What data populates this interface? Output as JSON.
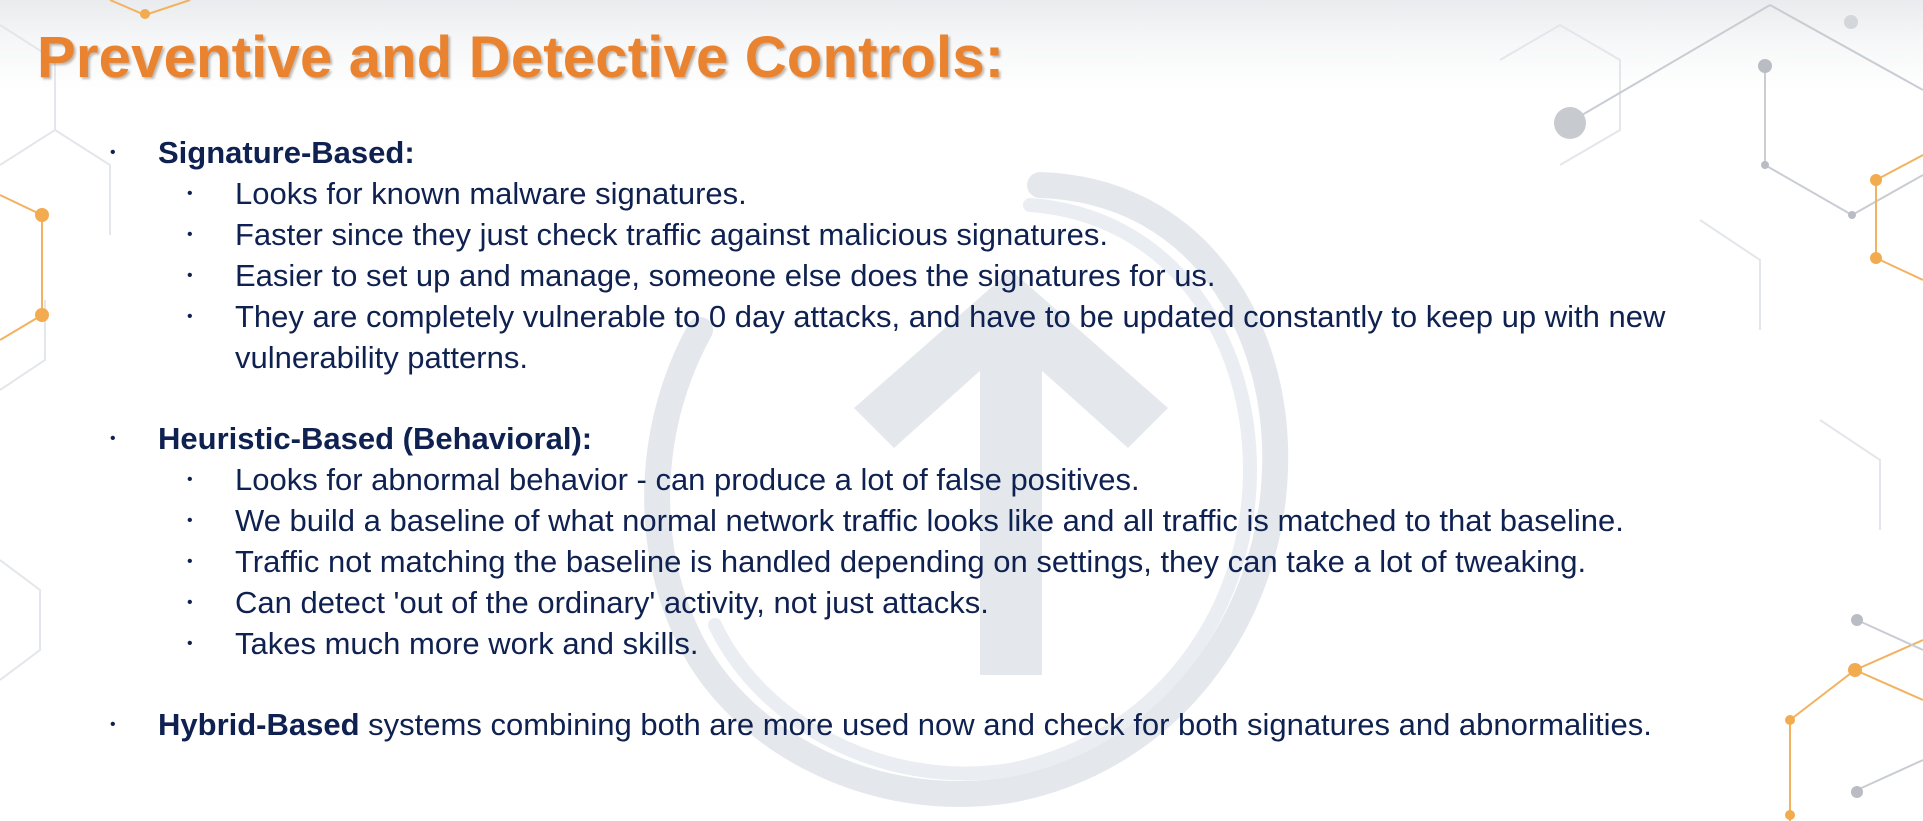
{
  "slide": {
    "title": "Preventive and Detective Controls:",
    "bullet_glyph": "•",
    "accent_color": "#e9832f",
    "text_color": "#0f2150"
  },
  "signature": {
    "heading": "Signature-Based:",
    "items": [
      "Looks for known malware signatures.",
      "Faster since they just check traffic against malicious signatures.",
      "Easier to set up and manage, someone else does the signatures for us.",
      "They are completely vulnerable to 0 day attacks, and have to be updated constantly to keep up with new"
    ],
    "item4_continuation": "vulnerability patterns."
  },
  "heuristic": {
    "heading": "Heuristic-Based (Behavioral):",
    "items": [
      "Looks for abnormal behavior - can produce a lot of false positives.",
      "We build a baseline of what normal network traffic looks like and all traffic is matched to that baseline.",
      "Traffic not matching the baseline is handled depending on settings, they can take a lot of tweaking.",
      "Can detect 'out of the ordinary' activity, not just attacks.",
      "Takes much more work and skills."
    ]
  },
  "hybrid": {
    "heading": "Hybrid-Based",
    "text": " systems combining both are more used now and check for both signatures and abnormalities."
  },
  "decor": {
    "watermark_icon": "arrow-up-circle-watermark",
    "network_icon": "hexagon-network-graphic"
  }
}
